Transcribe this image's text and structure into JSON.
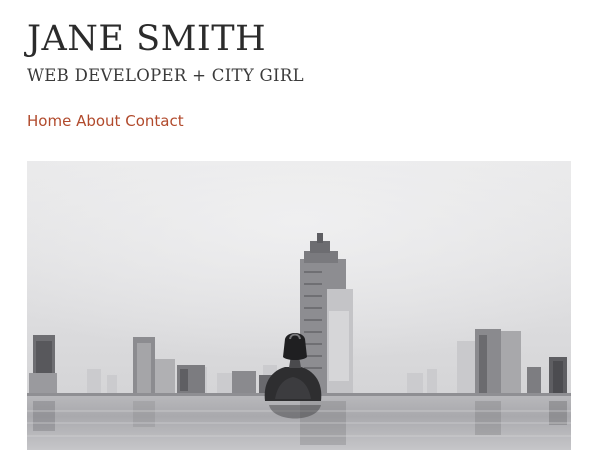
{
  "header": {
    "site_name": "JANE SMITH",
    "tagline": "WEB DEVELOPER + CITY GIRL"
  },
  "nav": {
    "items": [
      {
        "label": "Home"
      },
      {
        "label": "About"
      },
      {
        "label": "Contact"
      }
    ]
  },
  "theme": {
    "text_color": "#2b2b2b",
    "link_color": "#b14a2c",
    "background": "#ffffff"
  },
  "hero": {
    "style": "black-and-white photo",
    "subject": "woman in an infinity pool with a city skyline"
  }
}
